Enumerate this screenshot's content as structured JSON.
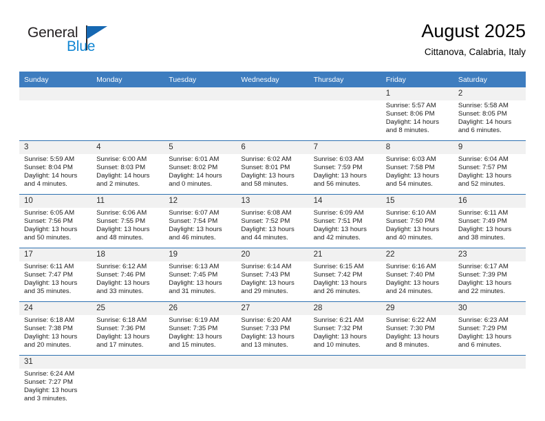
{
  "brand": {
    "name_part1": "General",
    "name_part2": "Blue",
    "flag_icon": "triangle-flag-icon"
  },
  "header": {
    "title": "August 2025",
    "subtitle": "Cittanova, Calabria, Italy"
  },
  "colors": {
    "header_blue": "#3e7dbf",
    "rule_blue": "#2b6fb0",
    "number_band": "#f1f1f1",
    "brand_blue": "#1186d3",
    "brand_flag": "#1668b2"
  },
  "weekday_headers": [
    "Sunday",
    "Monday",
    "Tuesday",
    "Wednesday",
    "Thursday",
    "Friday",
    "Saturday"
  ],
  "weeks": [
    {
      "days": [
        {
          "num": "",
          "sunrise": "",
          "sunset": "",
          "daylight1": "",
          "daylight2": ""
        },
        {
          "num": "",
          "sunrise": "",
          "sunset": "",
          "daylight1": "",
          "daylight2": ""
        },
        {
          "num": "",
          "sunrise": "",
          "sunset": "",
          "daylight1": "",
          "daylight2": ""
        },
        {
          "num": "",
          "sunrise": "",
          "sunset": "",
          "daylight1": "",
          "daylight2": ""
        },
        {
          "num": "",
          "sunrise": "",
          "sunset": "",
          "daylight1": "",
          "daylight2": ""
        },
        {
          "num": "1",
          "sunrise": "Sunrise: 5:57 AM",
          "sunset": "Sunset: 8:06 PM",
          "daylight1": "Daylight: 14 hours",
          "daylight2": "and 8 minutes."
        },
        {
          "num": "2",
          "sunrise": "Sunrise: 5:58 AM",
          "sunset": "Sunset: 8:05 PM",
          "daylight1": "Daylight: 14 hours",
          "daylight2": "and 6 minutes."
        }
      ]
    },
    {
      "days": [
        {
          "num": "3",
          "sunrise": "Sunrise: 5:59 AM",
          "sunset": "Sunset: 8:04 PM",
          "daylight1": "Daylight: 14 hours",
          "daylight2": "and 4 minutes."
        },
        {
          "num": "4",
          "sunrise": "Sunrise: 6:00 AM",
          "sunset": "Sunset: 8:03 PM",
          "daylight1": "Daylight: 14 hours",
          "daylight2": "and 2 minutes."
        },
        {
          "num": "5",
          "sunrise": "Sunrise: 6:01 AM",
          "sunset": "Sunset: 8:02 PM",
          "daylight1": "Daylight: 14 hours",
          "daylight2": "and 0 minutes."
        },
        {
          "num": "6",
          "sunrise": "Sunrise: 6:02 AM",
          "sunset": "Sunset: 8:01 PM",
          "daylight1": "Daylight: 13 hours",
          "daylight2": "and 58 minutes."
        },
        {
          "num": "7",
          "sunrise": "Sunrise: 6:03 AM",
          "sunset": "Sunset: 7:59 PM",
          "daylight1": "Daylight: 13 hours",
          "daylight2": "and 56 minutes."
        },
        {
          "num": "8",
          "sunrise": "Sunrise: 6:03 AM",
          "sunset": "Sunset: 7:58 PM",
          "daylight1": "Daylight: 13 hours",
          "daylight2": "and 54 minutes."
        },
        {
          "num": "9",
          "sunrise": "Sunrise: 6:04 AM",
          "sunset": "Sunset: 7:57 PM",
          "daylight1": "Daylight: 13 hours",
          "daylight2": "and 52 minutes."
        }
      ]
    },
    {
      "days": [
        {
          "num": "10",
          "sunrise": "Sunrise: 6:05 AM",
          "sunset": "Sunset: 7:56 PM",
          "daylight1": "Daylight: 13 hours",
          "daylight2": "and 50 minutes."
        },
        {
          "num": "11",
          "sunrise": "Sunrise: 6:06 AM",
          "sunset": "Sunset: 7:55 PM",
          "daylight1": "Daylight: 13 hours",
          "daylight2": "and 48 minutes."
        },
        {
          "num": "12",
          "sunrise": "Sunrise: 6:07 AM",
          "sunset": "Sunset: 7:54 PM",
          "daylight1": "Daylight: 13 hours",
          "daylight2": "and 46 minutes."
        },
        {
          "num": "13",
          "sunrise": "Sunrise: 6:08 AM",
          "sunset": "Sunset: 7:52 PM",
          "daylight1": "Daylight: 13 hours",
          "daylight2": "and 44 minutes."
        },
        {
          "num": "14",
          "sunrise": "Sunrise: 6:09 AM",
          "sunset": "Sunset: 7:51 PM",
          "daylight1": "Daylight: 13 hours",
          "daylight2": "and 42 minutes."
        },
        {
          "num": "15",
          "sunrise": "Sunrise: 6:10 AM",
          "sunset": "Sunset: 7:50 PM",
          "daylight1": "Daylight: 13 hours",
          "daylight2": "and 40 minutes."
        },
        {
          "num": "16",
          "sunrise": "Sunrise: 6:11 AM",
          "sunset": "Sunset: 7:49 PM",
          "daylight1": "Daylight: 13 hours",
          "daylight2": "and 38 minutes."
        }
      ]
    },
    {
      "days": [
        {
          "num": "17",
          "sunrise": "Sunrise: 6:11 AM",
          "sunset": "Sunset: 7:47 PM",
          "daylight1": "Daylight: 13 hours",
          "daylight2": "and 35 minutes."
        },
        {
          "num": "18",
          "sunrise": "Sunrise: 6:12 AM",
          "sunset": "Sunset: 7:46 PM",
          "daylight1": "Daylight: 13 hours",
          "daylight2": "and 33 minutes."
        },
        {
          "num": "19",
          "sunrise": "Sunrise: 6:13 AM",
          "sunset": "Sunset: 7:45 PM",
          "daylight1": "Daylight: 13 hours",
          "daylight2": "and 31 minutes."
        },
        {
          "num": "20",
          "sunrise": "Sunrise: 6:14 AM",
          "sunset": "Sunset: 7:43 PM",
          "daylight1": "Daylight: 13 hours",
          "daylight2": "and 29 minutes."
        },
        {
          "num": "21",
          "sunrise": "Sunrise: 6:15 AM",
          "sunset": "Sunset: 7:42 PM",
          "daylight1": "Daylight: 13 hours",
          "daylight2": "and 26 minutes."
        },
        {
          "num": "22",
          "sunrise": "Sunrise: 6:16 AM",
          "sunset": "Sunset: 7:40 PM",
          "daylight1": "Daylight: 13 hours",
          "daylight2": "and 24 minutes."
        },
        {
          "num": "23",
          "sunrise": "Sunrise: 6:17 AM",
          "sunset": "Sunset: 7:39 PM",
          "daylight1": "Daylight: 13 hours",
          "daylight2": "and 22 minutes."
        }
      ]
    },
    {
      "days": [
        {
          "num": "24",
          "sunrise": "Sunrise: 6:18 AM",
          "sunset": "Sunset: 7:38 PM",
          "daylight1": "Daylight: 13 hours",
          "daylight2": "and 20 minutes."
        },
        {
          "num": "25",
          "sunrise": "Sunrise: 6:18 AM",
          "sunset": "Sunset: 7:36 PM",
          "daylight1": "Daylight: 13 hours",
          "daylight2": "and 17 minutes."
        },
        {
          "num": "26",
          "sunrise": "Sunrise: 6:19 AM",
          "sunset": "Sunset: 7:35 PM",
          "daylight1": "Daylight: 13 hours",
          "daylight2": "and 15 minutes."
        },
        {
          "num": "27",
          "sunrise": "Sunrise: 6:20 AM",
          "sunset": "Sunset: 7:33 PM",
          "daylight1": "Daylight: 13 hours",
          "daylight2": "and 13 minutes."
        },
        {
          "num": "28",
          "sunrise": "Sunrise: 6:21 AM",
          "sunset": "Sunset: 7:32 PM",
          "daylight1": "Daylight: 13 hours",
          "daylight2": "and 10 minutes."
        },
        {
          "num": "29",
          "sunrise": "Sunrise: 6:22 AM",
          "sunset": "Sunset: 7:30 PM",
          "daylight1": "Daylight: 13 hours",
          "daylight2": "and 8 minutes."
        },
        {
          "num": "30",
          "sunrise": "Sunrise: 6:23 AM",
          "sunset": "Sunset: 7:29 PM",
          "daylight1": "Daylight: 13 hours",
          "daylight2": "and 6 minutes."
        }
      ]
    },
    {
      "days": [
        {
          "num": "31",
          "sunrise": "Sunrise: 6:24 AM",
          "sunset": "Sunset: 7:27 PM",
          "daylight1": "Daylight: 13 hours",
          "daylight2": "and 3 minutes."
        },
        {
          "num": "",
          "sunrise": "",
          "sunset": "",
          "daylight1": "",
          "daylight2": ""
        },
        {
          "num": "",
          "sunrise": "",
          "sunset": "",
          "daylight1": "",
          "daylight2": ""
        },
        {
          "num": "",
          "sunrise": "",
          "sunset": "",
          "daylight1": "",
          "daylight2": ""
        },
        {
          "num": "",
          "sunrise": "",
          "sunset": "",
          "daylight1": "",
          "daylight2": ""
        },
        {
          "num": "",
          "sunrise": "",
          "sunset": "",
          "daylight1": "",
          "daylight2": ""
        },
        {
          "num": "",
          "sunrise": "",
          "sunset": "",
          "daylight1": "",
          "daylight2": ""
        }
      ]
    }
  ]
}
